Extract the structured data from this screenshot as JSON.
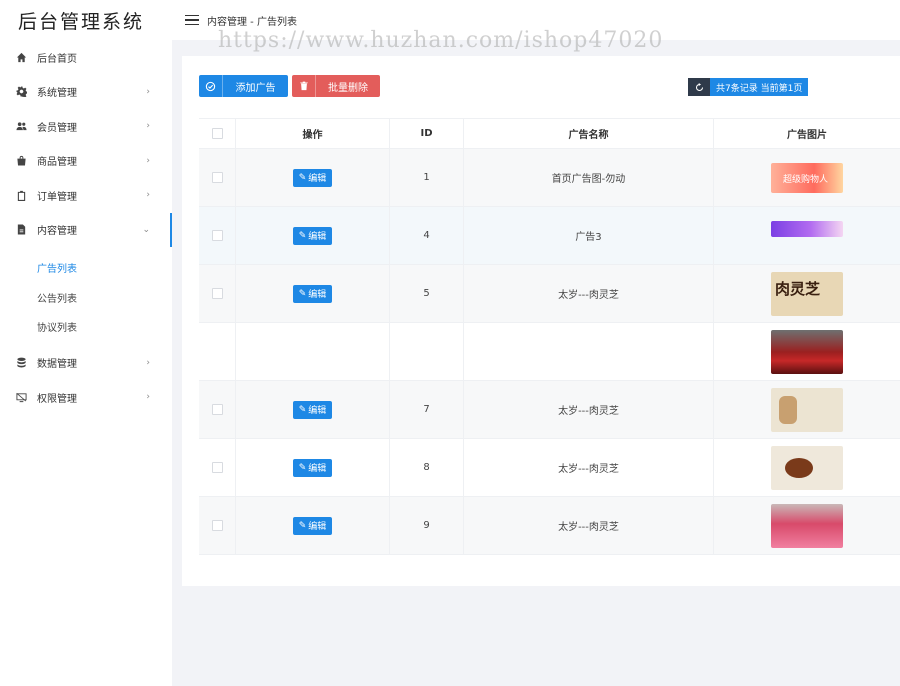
{
  "app": {
    "brand": "后台管理系统",
    "breadcrumb": "内容管理 - 广告列表",
    "watermark": "https://www.huzhan.com/ishop47020"
  },
  "sidebar": {
    "items": [
      {
        "label": "后台首页",
        "icon": "home-icon"
      },
      {
        "label": "系统管理",
        "icon": "gear-icon",
        "chevron": "›"
      },
      {
        "label": "会员管理",
        "icon": "users-icon",
        "chevron": "›"
      },
      {
        "label": "商品管理",
        "icon": "bag-icon",
        "chevron": "›"
      },
      {
        "label": "订单管理",
        "icon": "clipboard-icon",
        "chevron": "›"
      },
      {
        "label": "内容管理",
        "icon": "document-icon",
        "chevron": "⌄"
      },
      {
        "label": "数据管理",
        "icon": "database-icon",
        "chevron": "›"
      },
      {
        "label": "权限管理",
        "icon": "monitor-off-icon",
        "chevron": "›"
      }
    ],
    "content_sub": [
      "广告列表",
      "公告列表",
      "协议列表"
    ]
  },
  "toolbar": {
    "add_label": "添加广告",
    "delete_label": "批量删除",
    "record_info": "共7条记录 当前第1页"
  },
  "table": {
    "headers": [
      "操作",
      "ID",
      "广告名称",
      "广告图片"
    ],
    "edit_label": "编辑",
    "rows": [
      {
        "id": "1",
        "name": "首页广告图-勿动",
        "thumb_text": "超级购物人"
      },
      {
        "id": "4",
        "name": "广告3",
        "thumb_text": ""
      },
      {
        "id": "5",
        "name": "太岁---肉灵芝",
        "thumb_text": "肉灵芝"
      },
      {
        "id": "",
        "name": "",
        "thumb_text": ""
      },
      {
        "id": "7",
        "name": "太岁---肉灵芝",
        "thumb_text": ""
      },
      {
        "id": "8",
        "name": "太岁---肉灵芝",
        "thumb_text": ""
      },
      {
        "id": "9",
        "name": "太岁---肉灵芝",
        "thumb_text": ""
      }
    ]
  },
  "colors": {
    "primary": "#1e88e5",
    "danger": "#e35d5b",
    "dark_badge": "#2f3a4a"
  }
}
